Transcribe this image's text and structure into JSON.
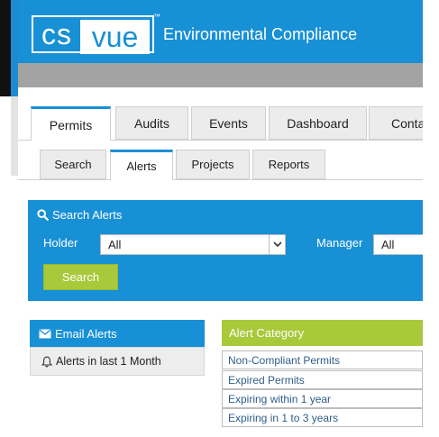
{
  "header": {
    "logo_left": "cs",
    "logo_right": "vue",
    "logo_tm": "™",
    "app_title": "Environmental Compliance"
  },
  "main_tabs": [
    {
      "label": "Permits",
      "active": true
    },
    {
      "label": "Audits",
      "active": false
    },
    {
      "label": "Events",
      "active": false
    },
    {
      "label": "Dashboard",
      "active": false
    },
    {
      "label": "Conta",
      "active": false
    }
  ],
  "sub_tabs": [
    {
      "label": "Search",
      "active": false
    },
    {
      "label": "Alerts",
      "active": true
    },
    {
      "label": "Projects",
      "active": false
    },
    {
      "label": "Reports",
      "active": false
    }
  ],
  "search_panel": {
    "title": "Search Alerts",
    "holder_label": "Holder",
    "holder_value": "All",
    "manager_label": "Manager",
    "manager_value": "All",
    "search_button": "Search"
  },
  "email_alerts": {
    "title": "Email Alerts",
    "item": "Alerts in last 1 Month"
  },
  "alert_category": {
    "title": "Alert Category",
    "items": [
      "Non-Compliant Permits",
      "Expired Permits",
      "Expiring within 1 year",
      "Expiring in 1 to 3 years"
    ]
  },
  "colors": {
    "brand_blue": "#1890d6",
    "accent_green": "#a8c93a"
  },
  "icons": [
    "search-icon",
    "envelope-icon",
    "bell-icon",
    "chevron-down-icon"
  ]
}
